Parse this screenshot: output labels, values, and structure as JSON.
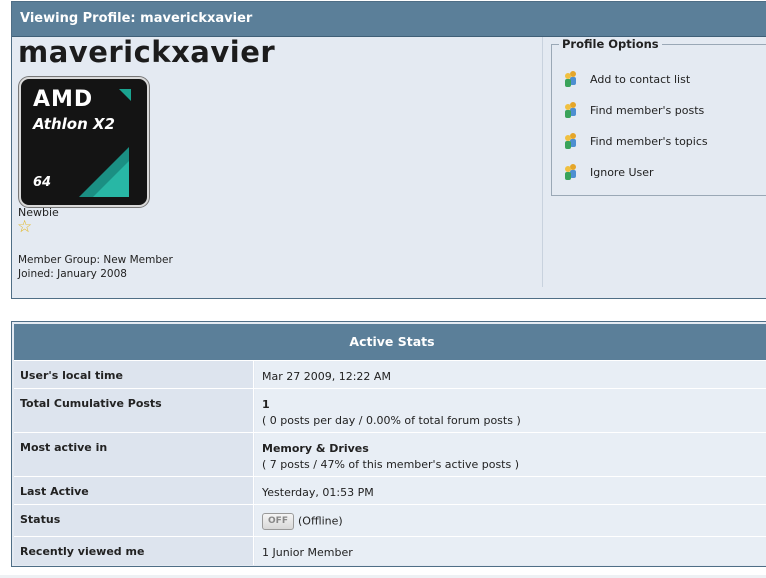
{
  "profile": {
    "header": "Viewing Profile: maverickxavier",
    "username": "maverickxavier",
    "avatar": {
      "brand": "AMD",
      "model": "Athlon X2",
      "bits": "64"
    },
    "rank": "Newbie",
    "member_group": "Member Group: New Member",
    "joined": "Joined: January 2008"
  },
  "options": {
    "legend": "Profile Options",
    "items": [
      {
        "label": "Add to contact list"
      },
      {
        "label": "Find member's posts"
      },
      {
        "label": "Find member's topics"
      },
      {
        "label": "Ignore User"
      }
    ]
  },
  "stats": {
    "title": "Active Stats",
    "local_time": {
      "label": "User's local time",
      "value": "Mar 27 2009, 12:22 AM"
    },
    "posts": {
      "label": "Total Cumulative Posts",
      "value": "1",
      "detail": "( 0 posts per day / 0.00% of total forum posts )"
    },
    "most_active": {
      "label": "Most active in",
      "value": "Memory & Drives",
      "detail": "( 7 posts / 47% of this member's active posts )"
    },
    "last_active": {
      "label": "Last Active",
      "value": "Yesterday, 01:53 PM"
    },
    "status": {
      "label": "Status",
      "badge": "OFF",
      "value": "(Offline)"
    },
    "recently_viewed": {
      "label": "Recently viewed me",
      "value": "1 Junior Member"
    }
  },
  "colors": {
    "header": "#5b7f99",
    "panel": "#e4eaf2"
  }
}
